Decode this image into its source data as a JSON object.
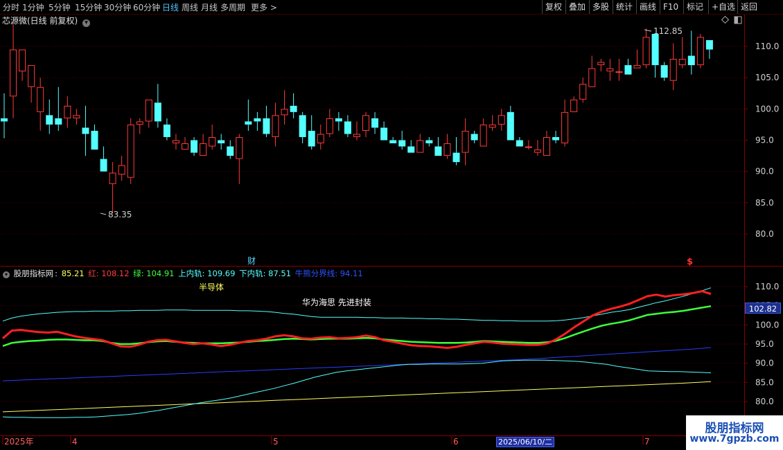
{
  "toolbar": {
    "periods": [
      "分时",
      "1分钟",
      "5分钟",
      "15分钟",
      "30分钟",
      "60分钟",
      "日线",
      "周线",
      "月线",
      "多周期",
      "更多 >"
    ],
    "active_period": "日线",
    "buttons": [
      "复权",
      "叠加",
      "多股",
      "统计",
      "画线",
      "F10",
      "标记",
      "+自选",
      "返回"
    ]
  },
  "main_chart": {
    "title": "芯源微(日线 前复权)",
    "y_ticks": [
      "110.0",
      "105.0",
      "100.0",
      "95.0",
      "90.0",
      "85.0",
      "80.0"
    ],
    "high_label": "112.85",
    "low_label": "83.35",
    "finance_marker": "财",
    "dividend_marker": "$",
    "colors": {
      "up": "#ff3b3b",
      "down": "#54ffff"
    }
  },
  "candles": [
    [
      98.5,
      102.5,
      95.3,
      98.0
    ],
    [
      102.0,
      113.5,
      98.5,
      109.5
    ],
    [
      106.0,
      108.5,
      104.5,
      109.5
    ],
    [
      103.5,
      106.5,
      101.0,
      107.0
    ],
    [
      99.5,
      105.0,
      96.5,
      103.5
    ],
    [
      99.0,
      101.5,
      96.0,
      97.5
    ],
    [
      98.5,
      103.5,
      96.5,
      97.5
    ],
    [
      98.5,
      102.0,
      97.0,
      100.5
    ],
    [
      98.5,
      100.0,
      97.5,
      99.0
    ],
    [
      97.0,
      100.5,
      92.5,
      96.0
    ],
    [
      96.5,
      97.5,
      93.5,
      93.5
    ],
    [
      92.0,
      94.0,
      90.5,
      90.0
    ],
    [
      88.0,
      91.5,
      83.35,
      89.8
    ],
    [
      89.5,
      92.5,
      88.5,
      91.0
    ],
    [
      89.0,
      98.5,
      88.0,
      97.5
    ],
    [
      97.5,
      98.5,
      96.0,
      98.0
    ],
    [
      98.0,
      101.5,
      97.0,
      101.5
    ],
    [
      101.0,
      104.0,
      97.0,
      98.0
    ],
    [
      97.5,
      98.5,
      95.0,
      95.5
    ],
    [
      94.5,
      96.0,
      93.5,
      95.0
    ],
    [
      93.5,
      95.5,
      94.0,
      94.5
    ],
    [
      95.0,
      95.5,
      92.5,
      93.0
    ],
    [
      92.5,
      96.0,
      92.5,
      94.5
    ],
    [
      94.0,
      97.5,
      93.5,
      95.5
    ],
    [
      95.0,
      96.0,
      93.5,
      94.5
    ],
    [
      94.0,
      95.0,
      92.0,
      92.5
    ],
    [
      92.0,
      96.0,
      88.0,
      95.5
    ],
    [
      98.0,
      101.5,
      96.5,
      97.5
    ],
    [
      98.5,
      99.5,
      96.5,
      98.0
    ],
    [
      98.5,
      100.5,
      95.5,
      96.0
    ],
    [
      95.5,
      101.0,
      94.0,
      99.0
    ],
    [
      99.0,
      103.0,
      97.5,
      100.0
    ],
    [
      100.5,
      102.5,
      98.5,
      99.5
    ],
    [
      99.0,
      99.5,
      94.5,
      95.5
    ],
    [
      96.5,
      99.0,
      93.5,
      94.0
    ],
    [
      94.5,
      97.5,
      93.5,
      96.0
    ],
    [
      96.0,
      100.0,
      95.5,
      98.5
    ],
    [
      98.5,
      99.5,
      96.5,
      98.0
    ],
    [
      98.0,
      99.0,
      95.5,
      96.0
    ],
    [
      95.5,
      98.0,
      95.0,
      96.0
    ],
    [
      96.5,
      99.5,
      95.5,
      99.0
    ],
    [
      98.5,
      99.5,
      96.0,
      97.0
    ],
    [
      97.0,
      98.0,
      95.0,
      95.0
    ],
    [
      95.0,
      95.5,
      94.5,
      94.5
    ],
    [
      95.0,
      96.5,
      93.5,
      94.0
    ],
    [
      94.0,
      95.0,
      93.5,
      93.0
    ],
    [
      93.0,
      96.0,
      93.0,
      95.0
    ],
    [
      95.0,
      95.5,
      94.0,
      94.5
    ],
    [
      94.0,
      95.5,
      92.5,
      92.5
    ],
    [
      92.5,
      96.0,
      92.0,
      94.5
    ],
    [
      93.0,
      95.5,
      91.0,
      91.5
    ],
    [
      93.0,
      98.5,
      91.0,
      96.5
    ],
    [
      96.0,
      96.5,
      94.5,
      95.0
    ],
    [
      94.0,
      98.5,
      94.0,
      97.5
    ],
    [
      97.0,
      99.0,
      96.5,
      97.5
    ],
    [
      97.5,
      100.0,
      96.5,
      99.0
    ],
    [
      99.5,
      100.5,
      96.5,
      95.0
    ],
    [
      95.0,
      95.5,
      94.0,
      94.0
    ],
    [
      94.0,
      95.0,
      93.5,
      94.0
    ],
    [
      93.0,
      95.0,
      92.5,
      93.5
    ],
    [
      92.5,
      96.5,
      92.5,
      95.5
    ],
    [
      95.5,
      96.5,
      94.5,
      95.0
    ],
    [
      94.5,
      101.5,
      94.0,
      99.5
    ],
    [
      99.5,
      102.0,
      99.5,
      101.5
    ],
    [
      101.5,
      105.0,
      101.0,
      104.0
    ],
    [
      103.5,
      108.5,
      103.5,
      106.5
    ],
    [
      107.0,
      108.0,
      106.0,
      107.5
    ],
    [
      106.0,
      108.0,
      104.5,
      106.5
    ],
    [
      106.0,
      108.0,
      104.5,
      106.0
    ],
    [
      107.0,
      108.0,
      105.5,
      105.5
    ],
    [
      106.5,
      109.5,
      106.5,
      107.0
    ],
    [
      107.0,
      112.85,
      106.5,
      111.5
    ],
    [
      112.0,
      111.5,
      105.0,
      107.0
    ],
    [
      107.0,
      107.5,
      104.5,
      105.0
    ],
    [
      104.5,
      110.5,
      103.0,
      108.0
    ],
    [
      107.0,
      111.5,
      106.5,
      108.0
    ],
    [
      108.5,
      112.5,
      105.5,
      107.0
    ],
    [
      107.0,
      112.0,
      106.5,
      111.5
    ],
    [
      111.0,
      110.5,
      108.0,
      109.5
    ]
  ],
  "indicator": {
    "name": "股朋指标网",
    "values": [
      {
        "label": "85.21",
        "color": "#ffff60"
      },
      {
        "label": "红: 108.12",
        "color": "#ff3b3b"
      },
      {
        "label": "绿: 104.91",
        "color": "#3cff3c"
      },
      {
        "label": "上内轨: 109.69",
        "color": "#54ffff"
      },
      {
        "label": "下内轨: 87.51",
        "color": "#54ffff"
      },
      {
        "label": "牛熊分界线: 94.11",
        "color": "#3050ff"
      }
    ],
    "annotation_1": "半导体",
    "annotation_2": "华为海思 先进封装",
    "last_value": "102.82",
    "y_ticks": [
      "110.0",
      "105.0",
      "100.0",
      "95.0",
      "90.0",
      "85.0",
      "80.0"
    ],
    "lines": {
      "upper": [
        101.0,
        101.8,
        102.3,
        102.6,
        102.9,
        103.1,
        103.3,
        103.4,
        103.5,
        103.5,
        103.6,
        103.6,
        103.6,
        103.7,
        103.7,
        103.8,
        103.8,
        103.8,
        103.9,
        103.9,
        103.9,
        103.8,
        103.8,
        103.8,
        103.8,
        103.8,
        103.7,
        103.7,
        103.6,
        103.5,
        103.3,
        103.0,
        102.8,
        102.5,
        102.2,
        102.0,
        102.0,
        102.0,
        102.0,
        102.0,
        101.9,
        101.9,
        101.8,
        101.8,
        101.8,
        101.7,
        101.7,
        101.6,
        101.6,
        101.5,
        101.5,
        101.4,
        101.3,
        101.2,
        101.2,
        101.1,
        101.1,
        101.0,
        101.0,
        101.0,
        101.0,
        101.1,
        101.3,
        101.6,
        101.9,
        102.4,
        102.8,
        103.3,
        103.6,
        104.0,
        104.6,
        105.2,
        105.8,
        106.3,
        106.9,
        107.5,
        108.2,
        108.9,
        109.7
      ],
      "red": [
        96.5,
        98.5,
        98.7,
        98.4,
        98.1,
        98.0,
        98.2,
        97.6,
        97.0,
        96.6,
        96.3,
        96.0,
        95.2,
        94.4,
        94.3,
        94.8,
        95.6,
        96.0,
        96.1,
        95.7,
        95.3,
        95.0,
        95.2,
        94.9,
        94.5,
        94.8,
        95.3,
        95.8,
        96.0,
        96.4,
        97.0,
        97.3,
        97.0,
        96.5,
        96.4,
        96.7,
        96.8,
        96.5,
        96.6,
        96.8,
        97.2,
        96.8,
        96.0,
        95.6,
        95.1,
        94.7,
        94.5,
        94.4,
        94.2,
        94.0,
        94.3,
        94.8,
        95.2,
        95.6,
        95.4,
        95.1,
        95.0,
        94.9,
        94.8,
        94.8,
        95.2,
        96.3,
        97.8,
        99.5,
        101.0,
        102.5,
        103.5,
        104.2,
        104.8,
        105.5,
        106.5,
        107.5,
        107.9,
        107.4,
        107.8,
        108.0,
        108.3,
        108.8,
        108.1
      ],
      "green": [
        94.5,
        95.3,
        95.6,
        95.8,
        95.9,
        96.1,
        96.2,
        96.2,
        96.1,
        96.0,
        96.0,
        95.8,
        95.3,
        95.0,
        95.0,
        95.2,
        95.5,
        95.7,
        95.8,
        95.6,
        95.4,
        95.3,
        95.2,
        95.2,
        95.2,
        95.3,
        95.4,
        95.6,
        95.8,
        95.9,
        96.1,
        96.3,
        96.4,
        96.3,
        96.2,
        96.3,
        96.4,
        96.4,
        96.4,
        96.5,
        96.6,
        96.5,
        96.2,
        96.0,
        95.8,
        95.6,
        95.5,
        95.4,
        95.3,
        95.3,
        95.3,
        95.4,
        95.6,
        95.8,
        95.7,
        95.6,
        95.5,
        95.4,
        95.3,
        95.3,
        95.5,
        95.9,
        96.6,
        97.5,
        98.3,
        99.1,
        99.8,
        100.3,
        100.7,
        101.2,
        101.9,
        102.6,
        102.9,
        103.2,
        103.4,
        103.7,
        104.1,
        104.5,
        104.9
      ],
      "lower": [
        76.0,
        75.9,
        75.9,
        75.8,
        75.8,
        75.8,
        75.8,
        75.9,
        75.9,
        76.0,
        76.2,
        76.4,
        76.6,
        76.9,
        77.3,
        77.7,
        78.2,
        78.7,
        79.2,
        79.7,
        80.1,
        80.5,
        81.0,
        81.6,
        82.2,
        82.8,
        83.4,
        84.1,
        84.8,
        85.6,
        86.4,
        87.0,
        87.6,
        88.0,
        88.3,
        88.6,
        88.9,
        89.2,
        89.5,
        89.7,
        89.7,
        89.8,
        89.8,
        89.8,
        89.8,
        89.9,
        90.0,
        90.3,
        90.6,
        90.7,
        90.8,
        90.8,
        90.8,
        90.7,
        90.6,
        90.5,
        90.3,
        90.0,
        89.7,
        89.2,
        88.8,
        88.4,
        88.0,
        87.9,
        87.8,
        87.8,
        87.7,
        87.6,
        87.5
      ],
      "bull_bear": [
        85.4,
        85.6,
        85.8,
        86.0,
        86.2,
        86.4,
        86.6,
        86.8,
        87.0,
        87.2,
        87.4,
        87.6,
        87.8,
        88.0,
        88.2,
        88.4,
        88.6,
        88.8,
        89.0,
        89.2,
        89.4,
        89.6,
        89.8,
        90.0,
        90.2,
        90.4,
        90.6,
        90.8,
        91.0,
        91.3,
        91.6,
        91.9,
        92.2,
        92.5,
        92.8,
        93.1,
        93.4,
        93.7,
        94.1
      ],
      "yellow": [
        77.3,
        77.6,
        77.9,
        78.2,
        78.5,
        78.8,
        79.1,
        79.4,
        79.7,
        80.0,
        80.3,
        80.6,
        80.9,
        81.2,
        81.5,
        81.8,
        82.1,
        82.4,
        82.7,
        83.0,
        83.3,
        83.6,
        83.9,
        84.2,
        84.5,
        84.8,
        85.2
      ]
    }
  },
  "x_axis": {
    "labels": [
      "2025年",
      "4",
      "5",
      "6",
      "7"
    ],
    "cursor_date": "2025/06/10/二"
  },
  "watermark": {
    "line1": "股朋指标网",
    "line2": "www.7gpzb.com"
  }
}
